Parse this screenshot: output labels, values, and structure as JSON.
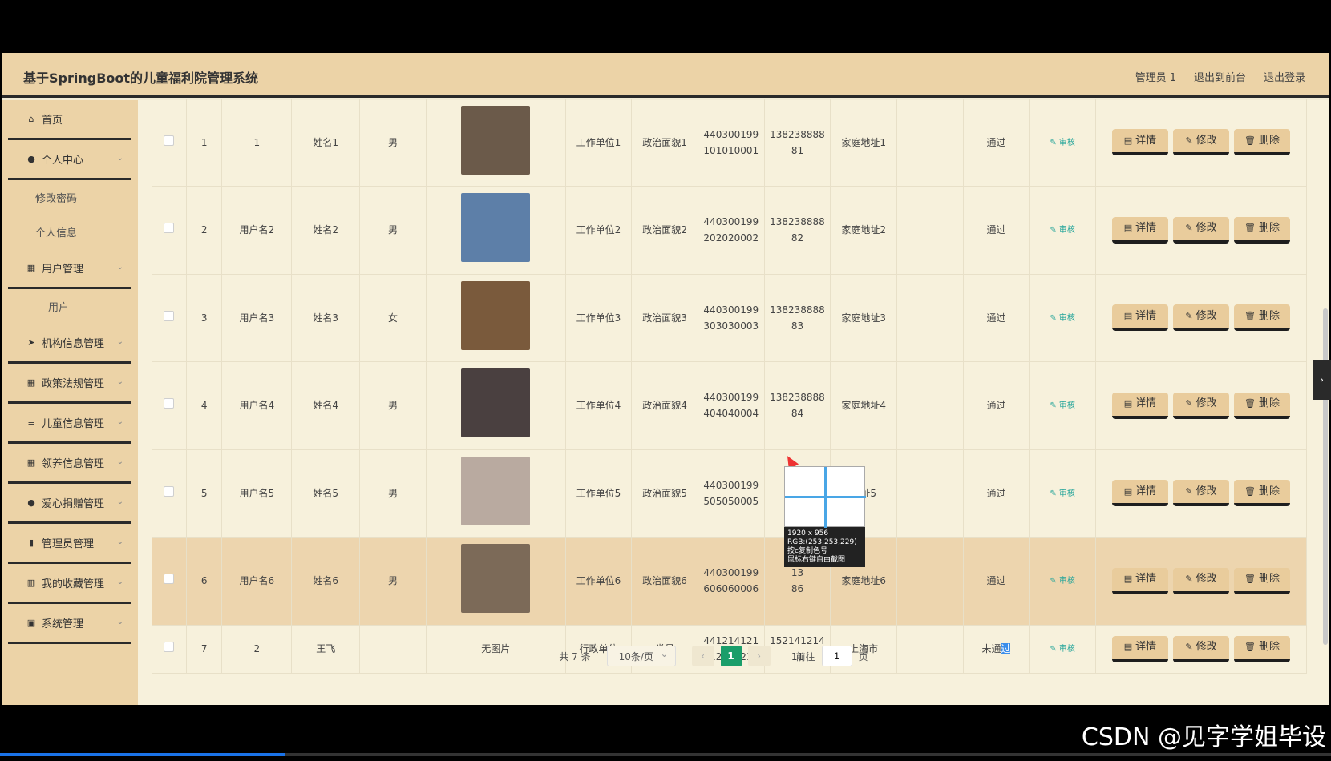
{
  "header": {
    "title": "基于SpringBoot的儿童福利院管理系统",
    "links": [
      "管理员 1",
      "退出到前台",
      "退出登录"
    ]
  },
  "sidebar": {
    "items": [
      {
        "label": "首页",
        "icon": "home-icon",
        "chev": false
      },
      {
        "label": "个人中心",
        "icon": "user-icon",
        "chev": true
      },
      {
        "label": "修改密码",
        "sub": true
      },
      {
        "label": "个人信息",
        "sub": true
      },
      {
        "label": "用户管理",
        "icon": "grid-icon",
        "chev": true
      },
      {
        "label": "用户",
        "sub": true,
        "deep": true
      },
      {
        "label": "机构信息管理",
        "icon": "send-icon",
        "chev": true
      },
      {
        "label": "政策法规管理",
        "icon": "grid-icon",
        "chev": true
      },
      {
        "label": "儿童信息管理",
        "icon": "list-icon",
        "chev": true
      },
      {
        "label": "领养信息管理",
        "icon": "grid-icon",
        "chev": true
      },
      {
        "label": "爱心捐赠管理",
        "icon": "user-icon",
        "chev": true
      },
      {
        "label": "管理员管理",
        "icon": "bar-icon",
        "chev": true
      },
      {
        "label": "我的收藏管理",
        "icon": "chart-icon",
        "chev": true
      },
      {
        "label": "系统管理",
        "icon": "clipboard-icon",
        "chev": true
      }
    ]
  },
  "table": {
    "rows": [
      {
        "index": "1",
        "username": "1",
        "name": "姓名1",
        "gender": "男",
        "photo": "photo",
        "work": "工作单位1",
        "politics": "政治面貌1",
        "id1": "440300199",
        "id2": "101010001",
        "phone1": "138238888",
        "phone2": "81",
        "address": "家庭地址1",
        "extra": "",
        "status": "通过",
        "color": "#6b5a4a"
      },
      {
        "index": "2",
        "username": "用户名2",
        "name": "姓名2",
        "gender": "男",
        "photo": "photo",
        "work": "工作单位2",
        "politics": "政治面貌2",
        "id1": "440300199",
        "id2": "202020002",
        "phone1": "138238888",
        "phone2": "82",
        "address": "家庭地址2",
        "extra": "",
        "status": "通过",
        "color": "#5d7fa8"
      },
      {
        "index": "3",
        "username": "用户名3",
        "name": "姓名3",
        "gender": "女",
        "photo": "photo",
        "work": "工作单位3",
        "politics": "政治面貌3",
        "id1": "440300199",
        "id2": "303030003",
        "phone1": "138238888",
        "phone2": "83",
        "address": "家庭地址3",
        "extra": "",
        "status": "通过",
        "color": "#7a5a3c"
      },
      {
        "index": "4",
        "username": "用户名4",
        "name": "姓名4",
        "gender": "男",
        "photo": "photo",
        "work": "工作单位4",
        "politics": "政治面貌4",
        "id1": "440300199",
        "id2": "404040004",
        "phone1": "138238888",
        "phone2": "84",
        "address": "家庭地址4",
        "extra": "",
        "status": "通过",
        "color": "#4a4040"
      },
      {
        "index": "5",
        "username": "用户名5",
        "name": "姓名5",
        "gender": "男",
        "photo": "photo",
        "work": "工作单位5",
        "politics": "政治面貌5",
        "id1": "440300199",
        "id2": "505050005",
        "phone1": "13",
        "phone2": "",
        "address": "地址5",
        "extra": "",
        "status": "通过",
        "color": "#b9aaa0"
      },
      {
        "index": "6",
        "username": "用户名6",
        "name": "姓名6",
        "gender": "男",
        "photo": "photo",
        "work": "工作单位6",
        "politics": "政治面貌6",
        "id1": "440300199",
        "id2": "606060006",
        "phone1": "13",
        "phone2": "86",
        "address": "家庭地址6",
        "extra": "",
        "status": "通过",
        "color": "#7c6a58"
      },
      {
        "index": "7",
        "username": "2",
        "name": "王飞",
        "gender": "",
        "photo": "无图片",
        "work": "行政单位",
        "politics": "党员",
        "id1": "441214121",
        "id2": "412141211",
        "phone1": "152141214",
        "phone2": "11",
        "address": "上海市",
        "extra": "",
        "status_a": "未通",
        "status_b": "过",
        "color": ""
      }
    ],
    "verify_label": "审核",
    "buttons": {
      "detail": "详情",
      "edit": "修改",
      "delete": "删除"
    }
  },
  "pagination": {
    "total": "共 7 条",
    "page_size": "10条/页",
    "current": "1",
    "goto_label": "前往",
    "goto_value": "1",
    "page_unit": "页"
  },
  "picker": {
    "size": "1920 x 956",
    "rgb": "RGB:(253,253,229)",
    "hint1": "按c复制色号",
    "hint2": "鼠标右键自由截图"
  },
  "watermark": "CSDN @见字学姐毕设"
}
